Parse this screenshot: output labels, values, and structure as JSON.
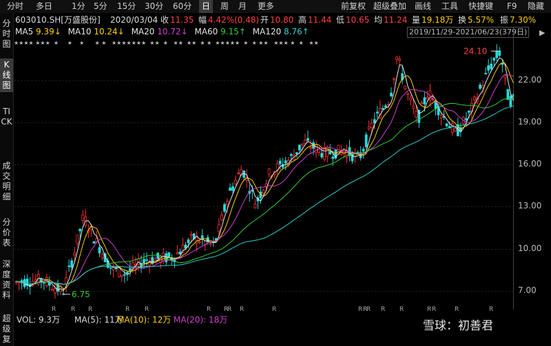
{
  "toolbar": {
    "tabs": [
      "分时",
      "多日",
      "1分",
      "5分",
      "15分",
      "30分",
      "60分",
      "日",
      "周",
      "月",
      "更多"
    ],
    "active_tab": "日",
    "right": [
      "前复权",
      "超级叠加",
      "画线",
      "工具",
      "快捷键",
      "F9",
      "隐藏"
    ]
  },
  "info": {
    "code": "603010.SH[万盛股份]",
    "date": "2020/03/04",
    "close_label": "收",
    "close": "11.35",
    "change_label": "幅",
    "change": "4.42%(0.48)",
    "open_label": "开",
    "open": "10.80",
    "high_label": "高",
    "high": "11.44",
    "low_label": "低",
    "low": "10.65",
    "avg_label": "均",
    "avg": "11.24",
    "vol_label": "量",
    "vol": "19.18万",
    "turnover_label": "换",
    "turnover": "5.57%",
    "amp_label": "振",
    "amp": "7.30%"
  },
  "ma": [
    {
      "label": "MA5",
      "value": "9.39↓",
      "color": "#e8e8e8",
      "vcolor": "#ffd200"
    },
    {
      "label": "MA10",
      "value": "10.24↓",
      "color": "#e8e8e8",
      "vcolor": "#ffd200"
    },
    {
      "label": "MA20",
      "value": "10.72↓",
      "color": "#e8e8e8",
      "vcolor": "#d040d0"
    },
    {
      "label": "MA60",
      "value": "9.15↑",
      "color": "#e8e8e8",
      "vcolor": "#33d033"
    },
    {
      "label": "MA120",
      "value": "8.76↑",
      "color": "#e8e8e8",
      "vcolor": "#33d0d0"
    }
  ],
  "range": "2019/11/29-2021/06/23(379日)",
  "sidebar": [
    "分时图",
    "K线图",
    "TICK",
    "成交明细",
    "分价表",
    "深度资料",
    "超级复"
  ],
  "stars": "★★★★ ★★★  ★     ★    ★      ★ ★   ★★★★★★★  ★★  ★   ★★  ★★  ★ ★  ★★★★★  ★  ★ ★★   ★★★ ★  ★   ★★",
  "chart_data": {
    "type": "candlestick",
    "y_ticks": [
      "22.00",
      "19.00",
      "16.00",
      "13.00",
      "10.00",
      "7.00"
    ],
    "ylim": [
      6.4,
      24.8
    ],
    "high_marker": "24.10",
    "low_marker": "6.75",
    "markers": [
      "R",
      "R",
      "R",
      "R",
      "R",
      "R",
      "R",
      "R",
      "R",
      "R",
      "R",
      "R",
      "R",
      "R",
      "R",
      "R",
      "R",
      "R",
      "R"
    ],
    "colors": {
      "up": "#ff3030",
      "down": "#27d9d9",
      "ma5": "#e8e8e8",
      "ma10": "#ffd200",
      "ma20": "#d040d0",
      "ma60": "#33d033",
      "ma120": "#33d0d0"
    }
  },
  "volume": {
    "vol": "VOL: 9.3万",
    "ma5": "MA(5): 11万",
    "ma10": "MA(10): 12万",
    "ma20": "MA(20): 18万"
  },
  "watermark": "雪球：初善君"
}
